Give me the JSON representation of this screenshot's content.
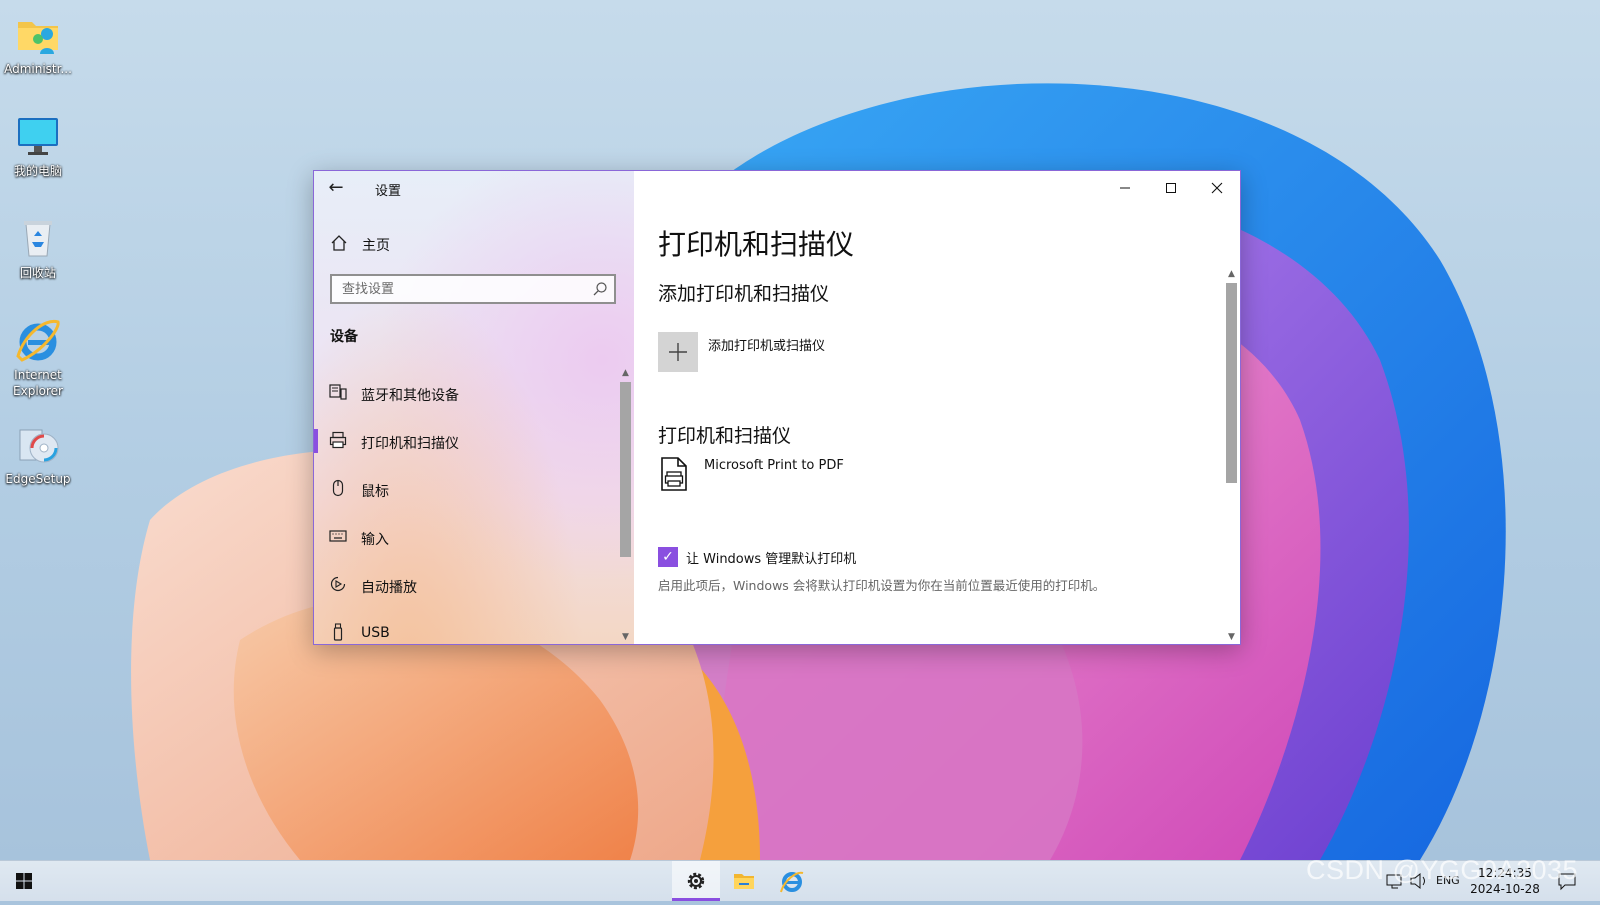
{
  "desktop": {
    "icons": [
      {
        "label": "Administr...",
        "icon": "user-folder-icon"
      },
      {
        "label": "我的电脑",
        "icon": "computer-icon"
      },
      {
        "label": "回收站",
        "icon": "recycle-bin-icon"
      },
      {
        "label": "Internet\nExplorer",
        "icon": "internet-explorer-icon"
      },
      {
        "label": "EdgeSetup",
        "icon": "setup-installer-icon"
      }
    ]
  },
  "window": {
    "title": "设置",
    "sidebar": {
      "home_label": "主页",
      "search_placeholder": "查找设置",
      "section_title": "设备",
      "items": [
        {
          "label": "蓝牙和其他设备",
          "icon": "bluetooth-devices-icon"
        },
        {
          "label": "打印机和扫描仪",
          "icon": "printer-icon",
          "selected": true
        },
        {
          "label": "鼠标",
          "icon": "mouse-icon"
        },
        {
          "label": "输入",
          "icon": "keyboard-icon"
        },
        {
          "label": "自动播放",
          "icon": "autoplay-icon"
        },
        {
          "label": "USB",
          "icon": "usb-icon"
        }
      ]
    },
    "main": {
      "page_title": "打印机和扫描仪",
      "add_section_title": "添加打印机和扫描仪",
      "add_button_label": "添加打印机或扫描仪",
      "list_section_title": "打印机和扫描仪",
      "printers": [
        {
          "name": "Microsoft Print to PDF",
          "icon": "printer-pdf-icon"
        }
      ],
      "manage_default": {
        "checked": true,
        "label": "让 Windows 管理默认打印机",
        "description": "启用此项后，Windows 会将默认打印机设置为你在当前位置最近使用的打印机。"
      }
    }
  },
  "taskbar": {
    "tray_network": "network-icon",
    "tray_volume": "volume-icon",
    "language": "ENG",
    "time": "12:24:35",
    "date": "2024-10-28"
  },
  "watermark": "CSDN @YGG0A2035",
  "colors": {
    "accent": "#8a4fe0"
  }
}
